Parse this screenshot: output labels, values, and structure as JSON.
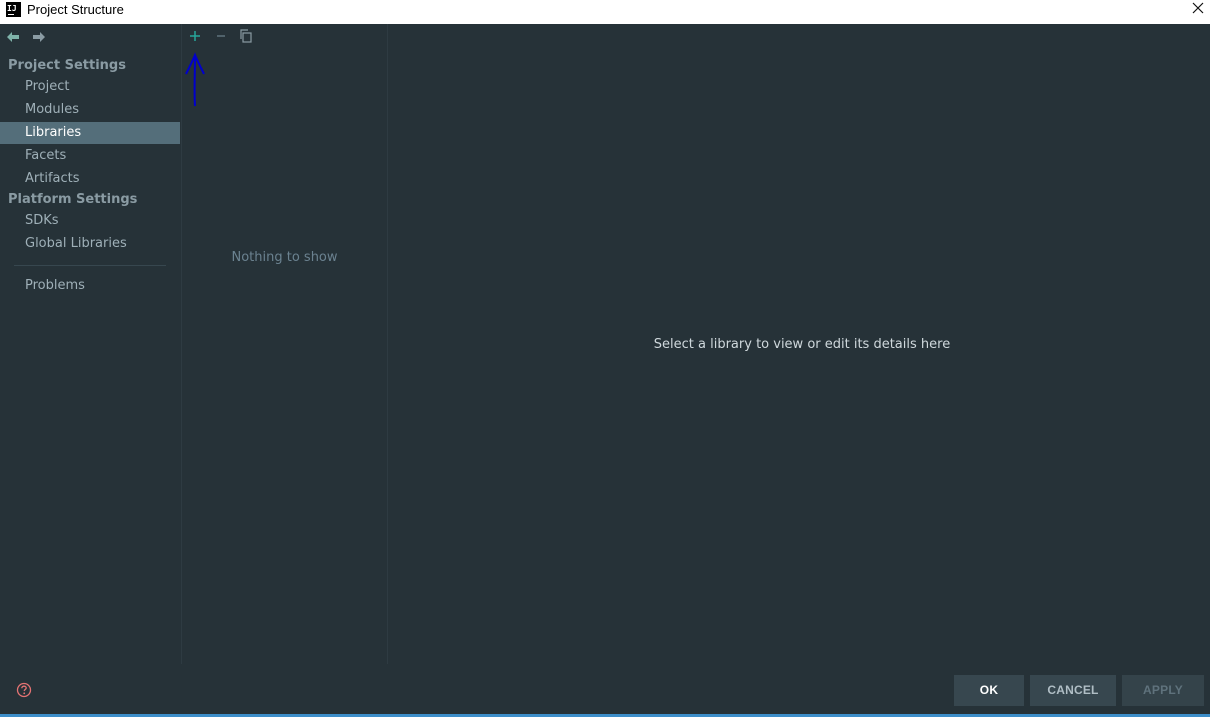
{
  "window": {
    "title": "Project Structure",
    "app_icon_label": "IJ"
  },
  "sidebar": {
    "project_settings_header": "Project Settings",
    "project_items": [
      {
        "label": "Project"
      },
      {
        "label": "Modules"
      },
      {
        "label": "Libraries",
        "selected": true
      },
      {
        "label": "Facets"
      },
      {
        "label": "Artifacts"
      }
    ],
    "platform_settings_header": "Platform Settings",
    "platform_items": [
      {
        "label": "SDKs"
      },
      {
        "label": "Global Libraries"
      }
    ],
    "problems_label": "Problems"
  },
  "list_panel": {
    "empty_text": "Nothing to show"
  },
  "detail_panel": {
    "placeholder_text": "Select a library to view or edit its details here"
  },
  "footer": {
    "ok_label": "OK",
    "cancel_label": "CANCEL",
    "apply_label": "APPLY"
  },
  "colors": {
    "background": "#263238",
    "selected_item": "#546e7a",
    "accent_plus": "#26a69a",
    "annotation": "#0000cc",
    "help_icon": "#e57373"
  },
  "icons": {
    "back": "arrow-left-icon",
    "forward": "arrow-right-icon",
    "add": "plus-icon",
    "remove": "minus-icon",
    "copy": "copy-icon",
    "help": "help-icon",
    "close": "close-icon"
  }
}
